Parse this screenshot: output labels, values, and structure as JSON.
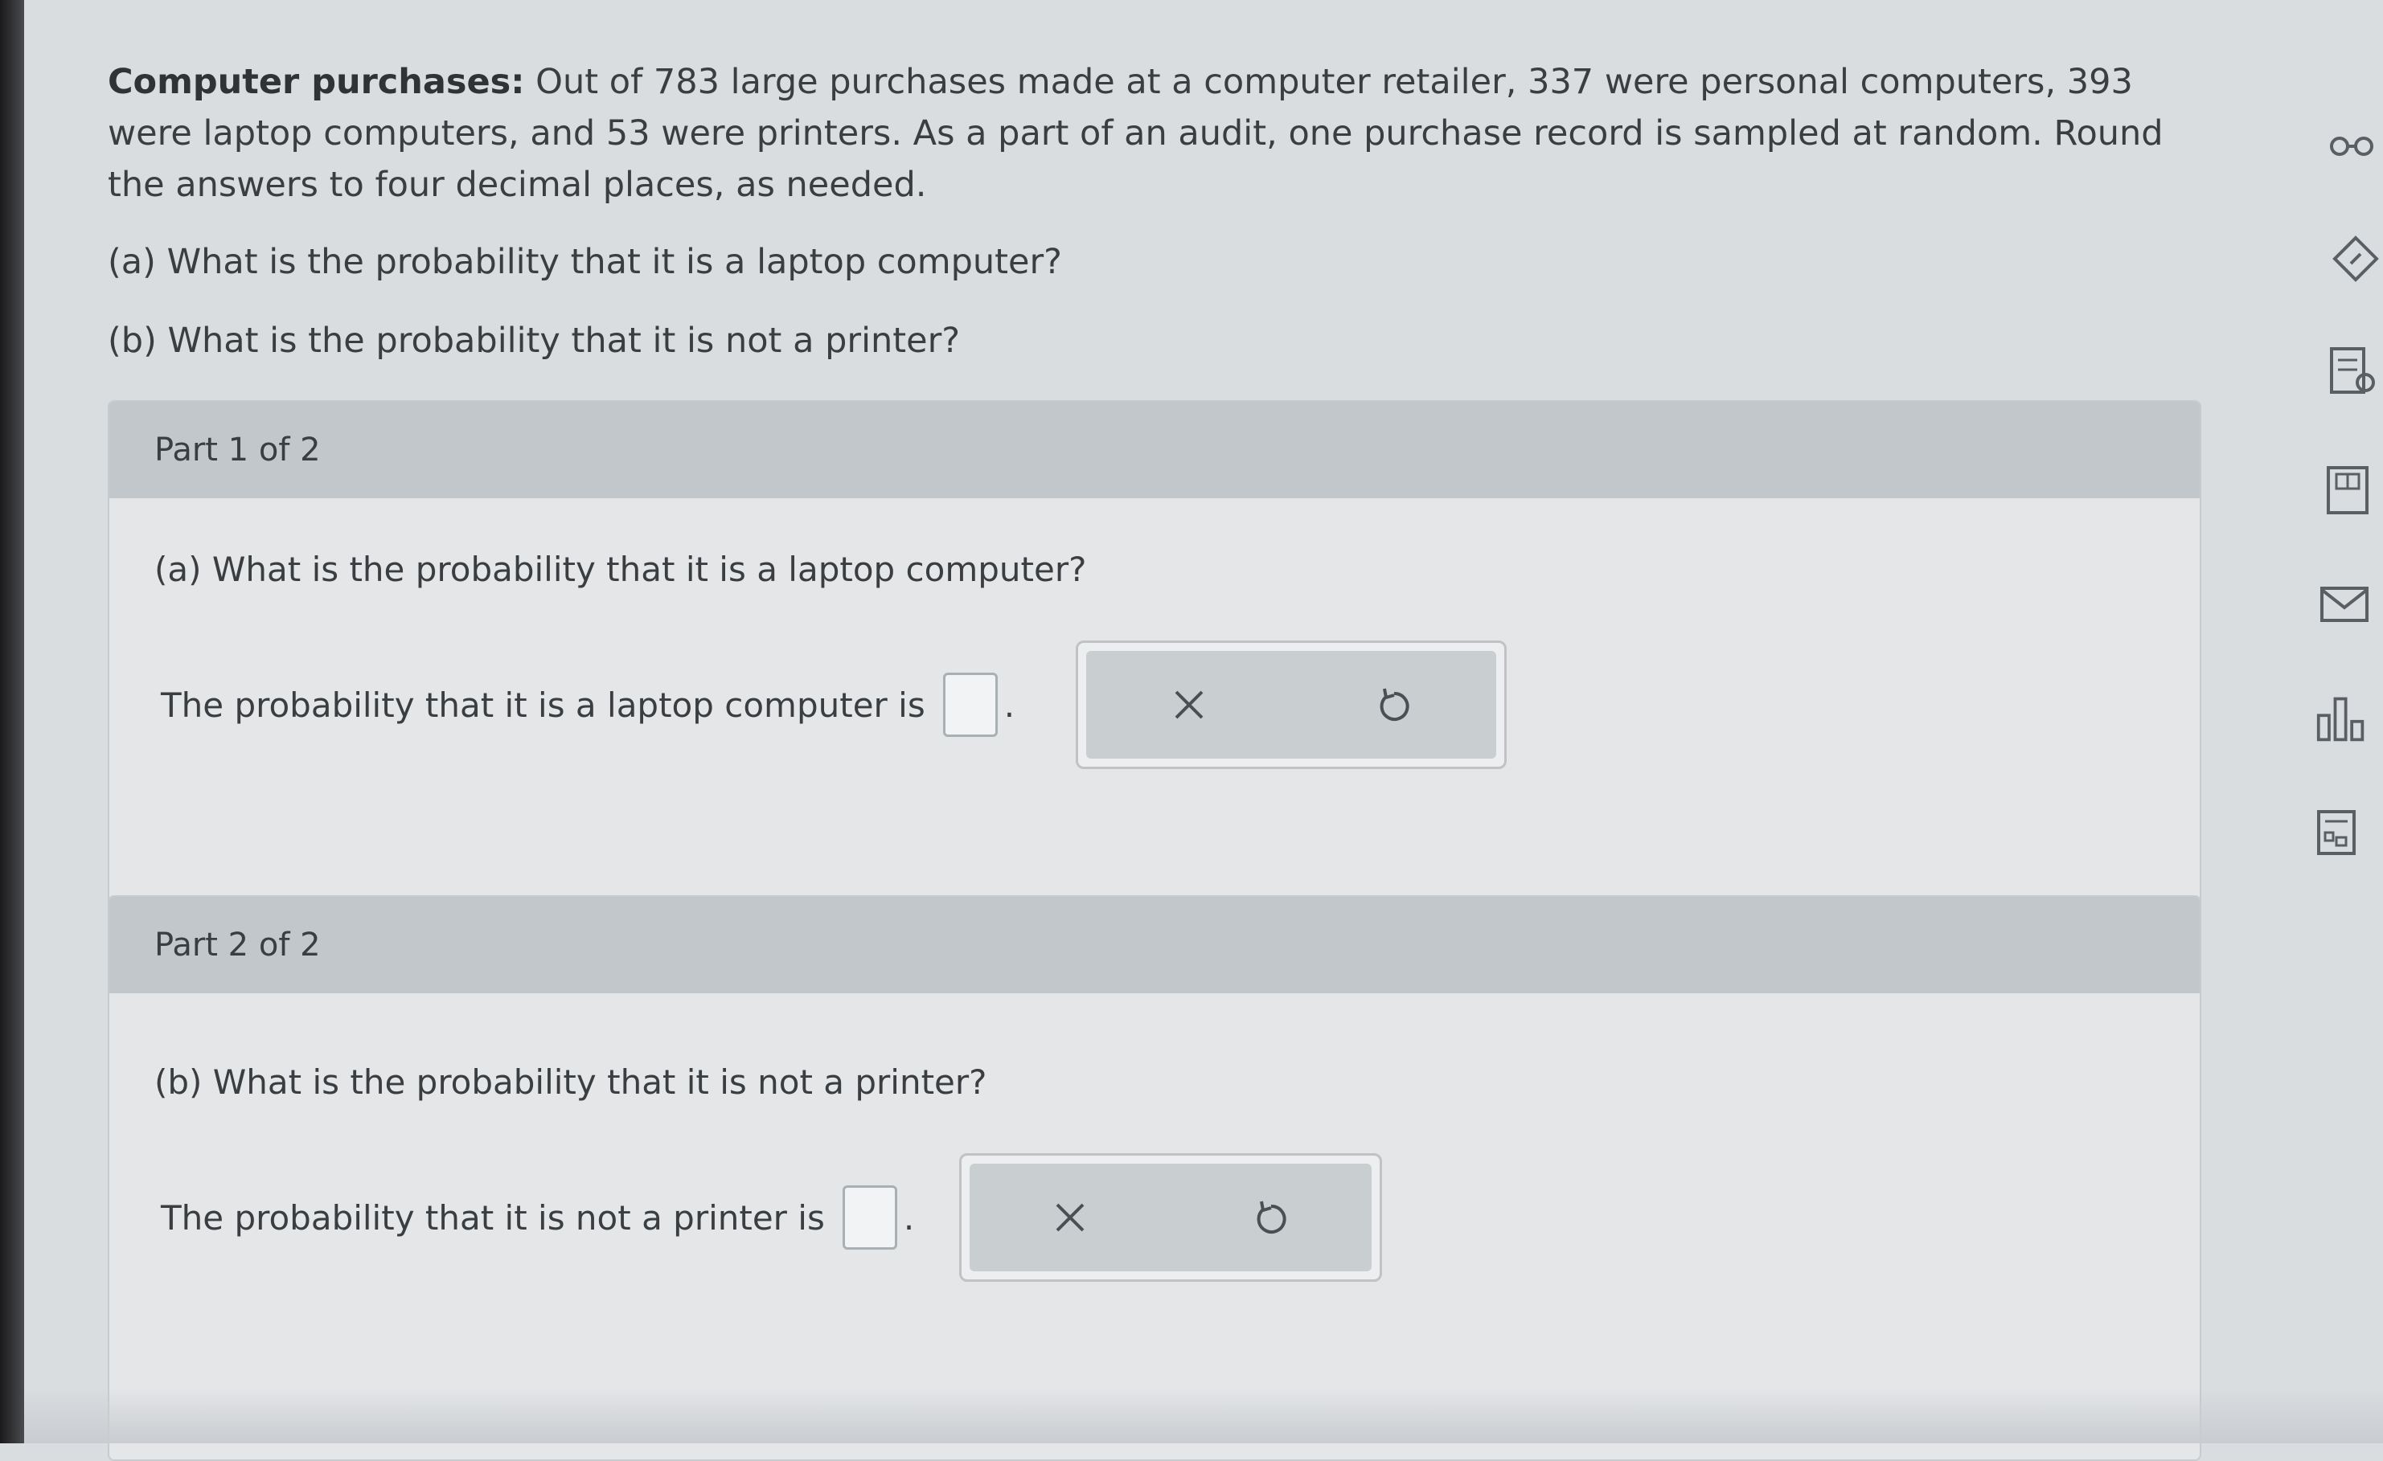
{
  "problem": {
    "title": "Computer purchases:",
    "statement": "Out of 783 large purchases made at a computer retailer, 337 were personal computers, 393 were laptop computers, and 53 were printers. As a part of an audit, one purchase record is sampled at random. Round the answers to four decimal places, as needed.",
    "question_a": "(a) What is the probability that it is a laptop computer?",
    "question_b": "(b) What is the probability that it is not a printer?"
  },
  "parts": [
    {
      "header": "Part 1 of 2",
      "question": "(a) What is the probability that it is a laptop computer?",
      "answer_prefix": "The probability that it is a laptop computer is",
      "answer_value": "",
      "answer_suffix": "."
    },
    {
      "header": "Part 2 of 2",
      "question": "(b) What is the probability that it is not a printer?",
      "answer_prefix": "The probability that it is not a printer is",
      "answer_value": "",
      "answer_suffix": "."
    }
  ],
  "toolbar": {
    "clear_icon": "close-icon",
    "undo_icon": "undo-icon"
  },
  "right_rail": {
    "icons": [
      "glasses-icon",
      "pencil-icon",
      "notes-icon",
      "calculator-icon",
      "mail-icon",
      "bar-chart-icon",
      "table-icon"
    ]
  }
}
